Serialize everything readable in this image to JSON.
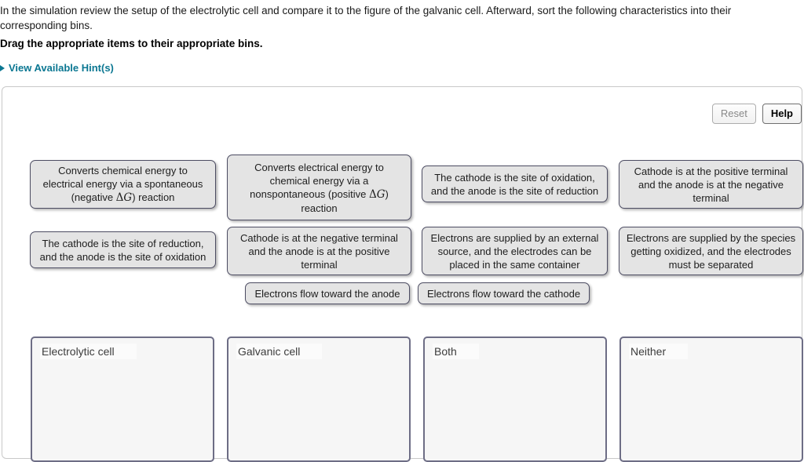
{
  "intro": {
    "paragraph": "In the simulation review the setup of the electrolytic cell and compare it to the figure of the galvanic cell. Afterward, sort the following characteristics into their corresponding bins.",
    "instruction": "Drag the appropriate items to their appropriate bins.",
    "hint_link": "View Available Hint(s)"
  },
  "toolbar": {
    "reset_label": "Reset",
    "help_label": "Help"
  },
  "items": [
    {
      "id": "converts-chemical-to-electrical",
      "text_parts": [
        "Converts chemical energy to electrical energy via a spontaneous (negative ",
        "ΔG",
        ") reaction"
      ],
      "text": "Converts chemical energy to electrical energy via a spontaneous (negative ΔG) reaction"
    },
    {
      "id": "converts-electrical-to-chemical",
      "text_parts": [
        "Converts electrical energy to chemical energy via a nonspontaneous (positive ",
        "ΔG",
        ") reaction"
      ],
      "text": "Converts electrical energy to chemical energy via a nonspontaneous (positive ΔG) reaction"
    },
    {
      "id": "cathode-oxidation-anode-reduction",
      "text": "The cathode is the site of oxidation, and the anode is the site of reduction"
    },
    {
      "id": "cathode-positive-anode-negative",
      "text": "Cathode is at the positive terminal and the anode is at the negative terminal"
    },
    {
      "id": "cathode-reduction-anode-oxidation",
      "text": "The cathode is the site of reduction, and the anode is the site of oxidation"
    },
    {
      "id": "cathode-negative-anode-positive",
      "text": "Cathode is at the negative terminal and the anode is at the positive terminal"
    },
    {
      "id": "electrons-external-source",
      "text": "Electrons are supplied by an external source, and the electrodes can be placed in the same container"
    },
    {
      "id": "electrons-species-oxidized",
      "text": "Electrons are supplied by the species getting oxidized, and the electrodes must be separated"
    },
    {
      "id": "electrons-flow-toward-anode",
      "text": "Electrons flow toward the anode"
    },
    {
      "id": "electrons-flow-toward-cathode",
      "text": "Electrons flow toward the cathode"
    }
  ],
  "bins": [
    {
      "id": "electrolytic-cell",
      "label": "Electrolytic cell"
    },
    {
      "id": "galvanic-cell",
      "label": "Galvanic cell"
    },
    {
      "id": "both",
      "label": "Both"
    },
    {
      "id": "neither",
      "label": "Neither"
    }
  ],
  "colors": {
    "link": "#0b7792",
    "item_border": "#4d4d63",
    "item_fill": "#e4e4e4",
    "bin_border": "#6d6d85",
    "bin_fill": "#f6f6f6",
    "panel_border": "#c9c9c9"
  }
}
